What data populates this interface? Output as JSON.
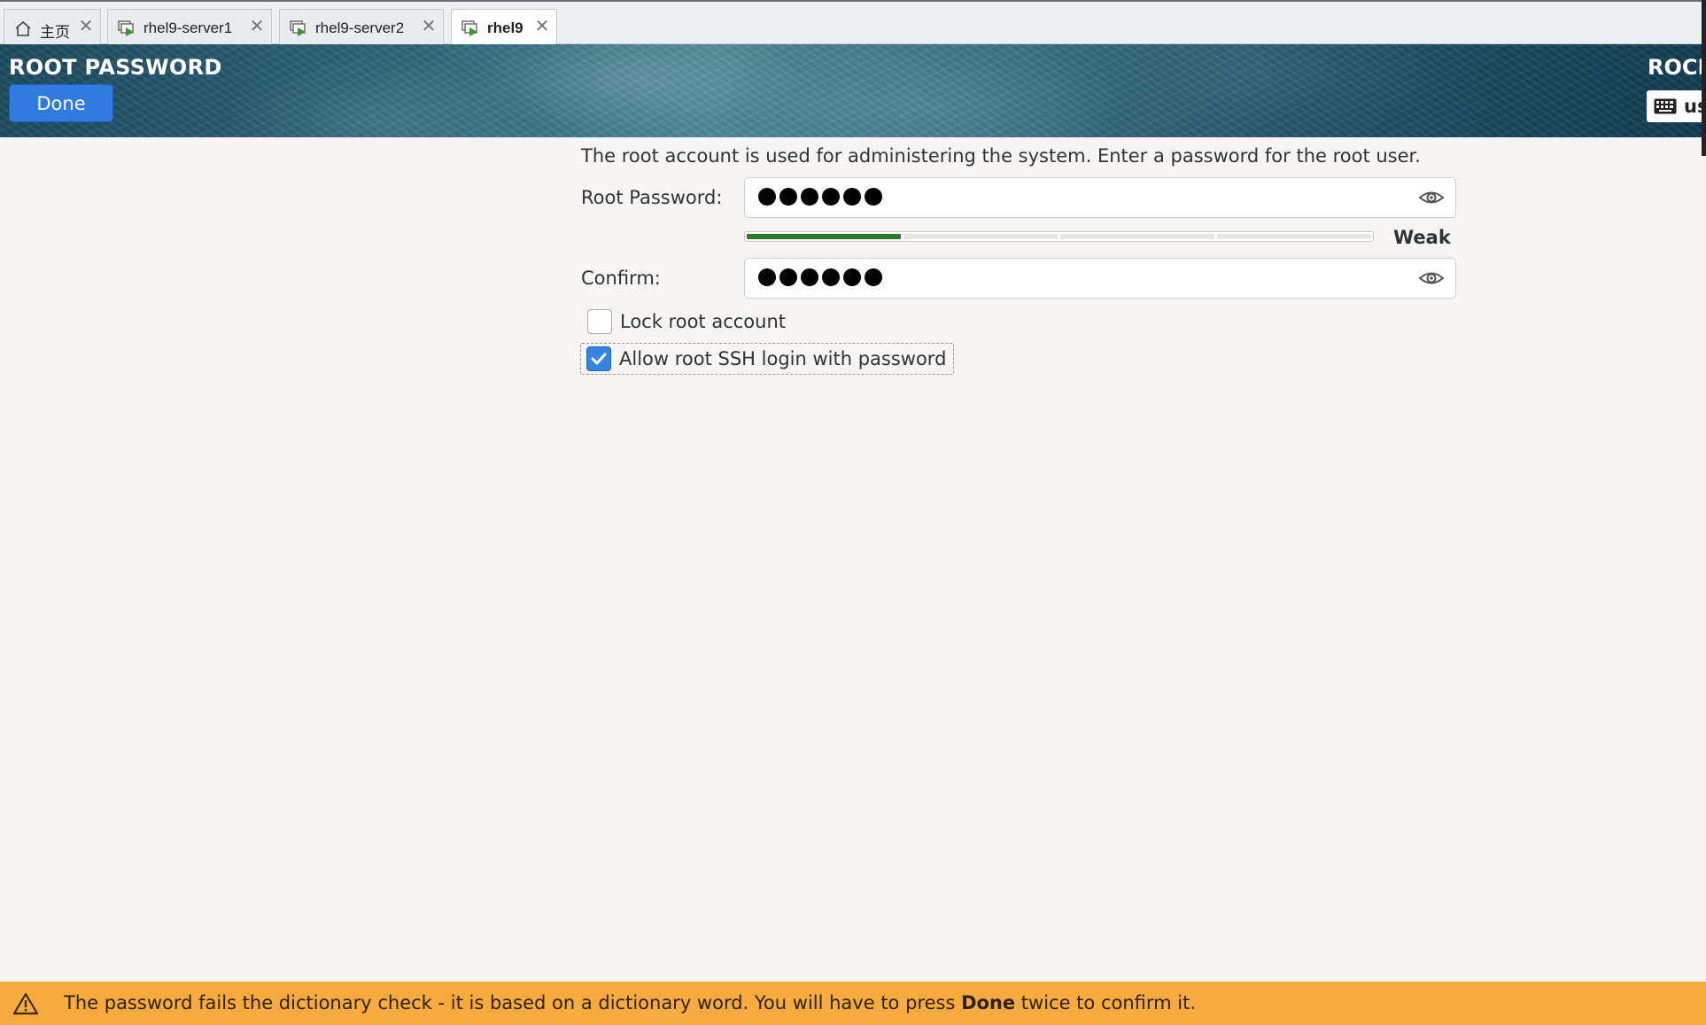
{
  "tabs": [
    {
      "label": "主页",
      "icon": "home-icon",
      "active": false
    },
    {
      "label": "rhel9-server1",
      "icon": "vm-running-icon",
      "active": false
    },
    {
      "label": "rhel9-server2",
      "icon": "vm-running-icon",
      "active": false
    },
    {
      "label": "rhel9",
      "icon": "vm-running-icon",
      "active": true
    }
  ],
  "header": {
    "title": "ROOT PASSWORD",
    "done_label": "Done",
    "product": "ROCKY",
    "keyboard_layout": "us"
  },
  "form": {
    "intro": "The root account is used for administering the system.  Enter a password for the root user.",
    "root_password_label": "Root Password:",
    "confirm_label": "Confirm:",
    "password_mask_length": 6,
    "strength_label": "Weak",
    "strength_level": 0.25,
    "lock_root_label": "Lock root account",
    "lock_root_checked": false,
    "allow_ssh_label": "Allow root SSH login with password",
    "allow_ssh_checked": true
  },
  "warning": {
    "text_before": "The password fails the dictionary check - it is based on a dictionary word. You will have to press ",
    "emphasis": "Done",
    "text_after": " twice to confirm it."
  },
  "colors": {
    "accent": "#3584e4",
    "done_button": "#2f7be0",
    "warning_bar": "#f8ab3d",
    "strength_fill": "#2a7a2a"
  }
}
